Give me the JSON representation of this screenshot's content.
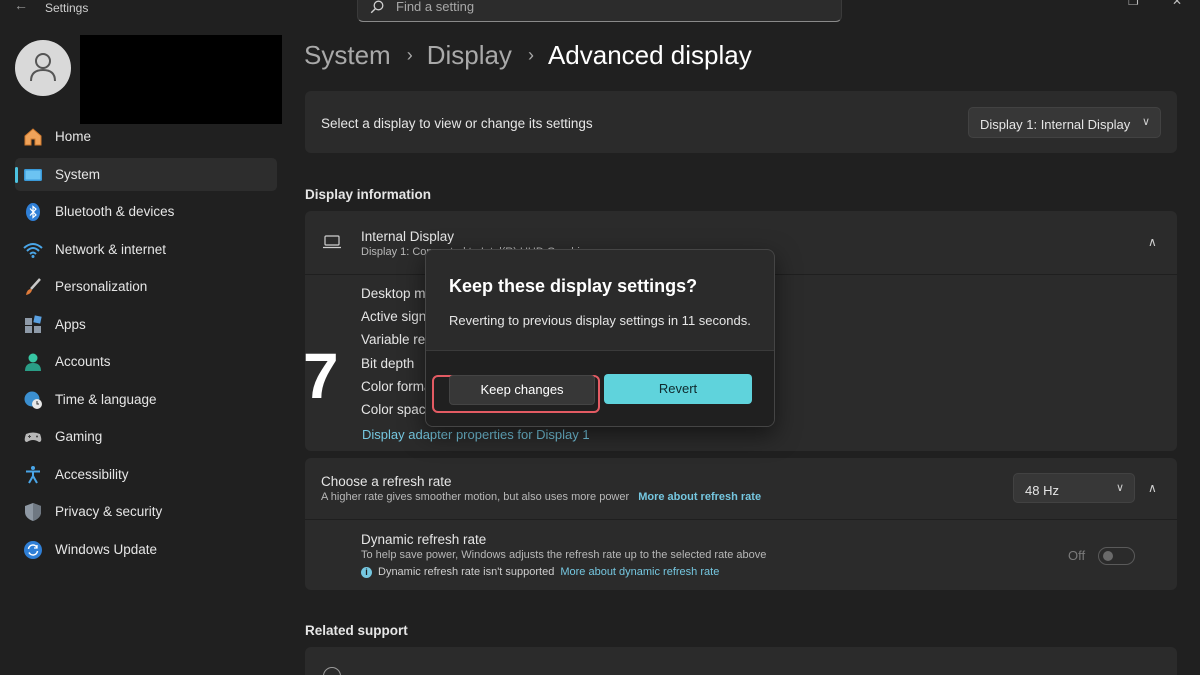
{
  "window": {
    "title": "Settings",
    "back_icon": "←",
    "restore_icon": "❐",
    "close_icon": "✕"
  },
  "search": {
    "placeholder": "Find a setting",
    "value": ""
  },
  "sidebar": {
    "items": [
      {
        "label": "Home",
        "icon": "home-icon"
      },
      {
        "label": "System",
        "icon": "system-icon",
        "active": true
      },
      {
        "label": "Bluetooth & devices",
        "icon": "bluetooth-icon"
      },
      {
        "label": "Network & internet",
        "icon": "wifi-icon"
      },
      {
        "label": "Personalization",
        "icon": "brush-icon"
      },
      {
        "label": "Apps",
        "icon": "apps-icon"
      },
      {
        "label": "Accounts",
        "icon": "account-icon"
      },
      {
        "label": "Time & language",
        "icon": "clock-globe-icon"
      },
      {
        "label": "Gaming",
        "icon": "gamepad-icon"
      },
      {
        "label": "Accessibility",
        "icon": "accessibility-icon"
      },
      {
        "label": "Privacy & security",
        "icon": "shield-icon"
      },
      {
        "label": "Windows Update",
        "icon": "update-icon"
      }
    ]
  },
  "breadcrumb": {
    "part1": "System",
    "part2": "Display",
    "current": "Advanced display",
    "separator": "›"
  },
  "select_display": {
    "label": "Select a display to view or change its settings",
    "value": "Display 1: Internal Display",
    "chevron": "∨"
  },
  "display_information": {
    "section_title": "Display information",
    "name": "Internal Display",
    "subtitle": "Display 1: Connected to Intel(R) UHD Graphics",
    "chevron": "∧",
    "rows": [
      "Desktop mode",
      "Active signal mode",
      "Variable refresh rate",
      "Bit depth",
      "Color format",
      "Color space"
    ],
    "adapter_link": "Display adapter properties for Display 1"
  },
  "refresh_rate": {
    "title": "Choose a refresh rate",
    "description": "A higher rate gives smoother motion, but also uses more power",
    "more_link": "More about refresh rate",
    "value": "48 Hz",
    "chevron_down": "∨",
    "chevron_up": "∧"
  },
  "dynamic_refresh": {
    "title": "Dynamic refresh rate",
    "description": "To help save power, Windows adjusts the refresh rate up to the selected rate above",
    "info_icon": "i",
    "note": "Dynamic refresh rate isn't supported",
    "more_link": "More about dynamic refresh rate",
    "toggle_label": "Off",
    "enabled": false
  },
  "related_support": {
    "section_title": "Related support"
  },
  "dialog": {
    "title": "Keep these display settings?",
    "message": "Reverting to previous display settings in 11 seconds.",
    "keep_label": "Keep changes",
    "revert_label": "Revert"
  },
  "step_number": "7",
  "colors": {
    "accent": "#5fd3dc",
    "link": "#75c7e0",
    "highlight": "#e35b63",
    "background": "#202020",
    "card": "#2b2b2b"
  }
}
